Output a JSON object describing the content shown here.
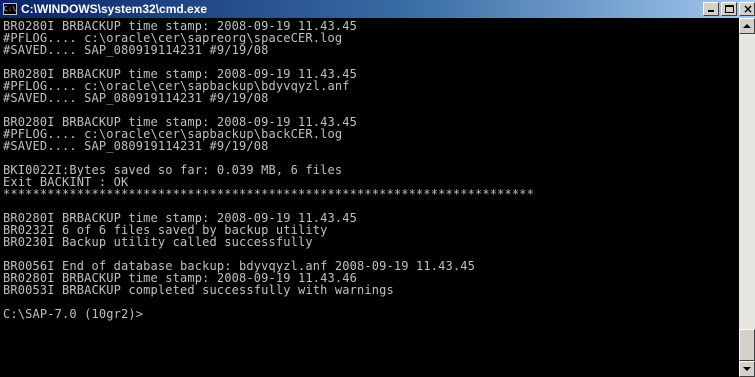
{
  "window": {
    "title": "C:\\WINDOWS\\system32\\cmd.exe",
    "icon": "cmd-icon",
    "controls": {
      "minimize": "minimize-icon",
      "maximize": "maximize-icon",
      "close_glyph": "×"
    }
  },
  "console": {
    "background": "#000000",
    "foreground": "#c0c0c0",
    "lines": [
      "BR0280I BRBACKUP time stamp: 2008-09-19 11.43.45",
      "#PFLOG.... c:\\oracle\\cer\\sapreorg\\spaceCER.log",
      "#SAVED.... SAP_080919114231 #9/19/08",
      "",
      "BR0280I BRBACKUP time stamp: 2008-09-19 11.43.45",
      "#PFLOG.... c:\\oracle\\cer\\sapbackup\\bdyvqyzl.anf",
      "#SAVED.... SAP_080919114231 #9/19/08",
      "",
      "BR0280I BRBACKUP time stamp: 2008-09-19 11.43.45",
      "#PFLOG.... c:\\oracle\\cer\\sapbackup\\backCER.log",
      "#SAVED.... SAP_080919114231 #9/19/08",
      "",
      "BKI0022I:Bytes saved so far: 0.039 MB, 6 files",
      "Exit BACKINT : OK",
      "************************************************************************",
      "",
      "BR0280I BRBACKUP time stamp: 2008-09-19 11.43.45",
      "BR0232I 6 of 6 files saved by backup utility",
      "BR0230I Backup utility called successfully",
      "",
      "BR0056I End of database backup: bdyvqyzl.anf 2008-09-19 11.43.45",
      "BR0280I BRBACKUP time stamp: 2008-09-19 11.43.46",
      "BR0053I BRBACKUP completed successfully with warnings",
      "",
      "C:\\SAP-7.0 (10gr2)>"
    ]
  },
  "scrollbar": {
    "up_icon": "scroll-up-arrow-icon",
    "down_icon": "scroll-down-arrow-icon"
  }
}
